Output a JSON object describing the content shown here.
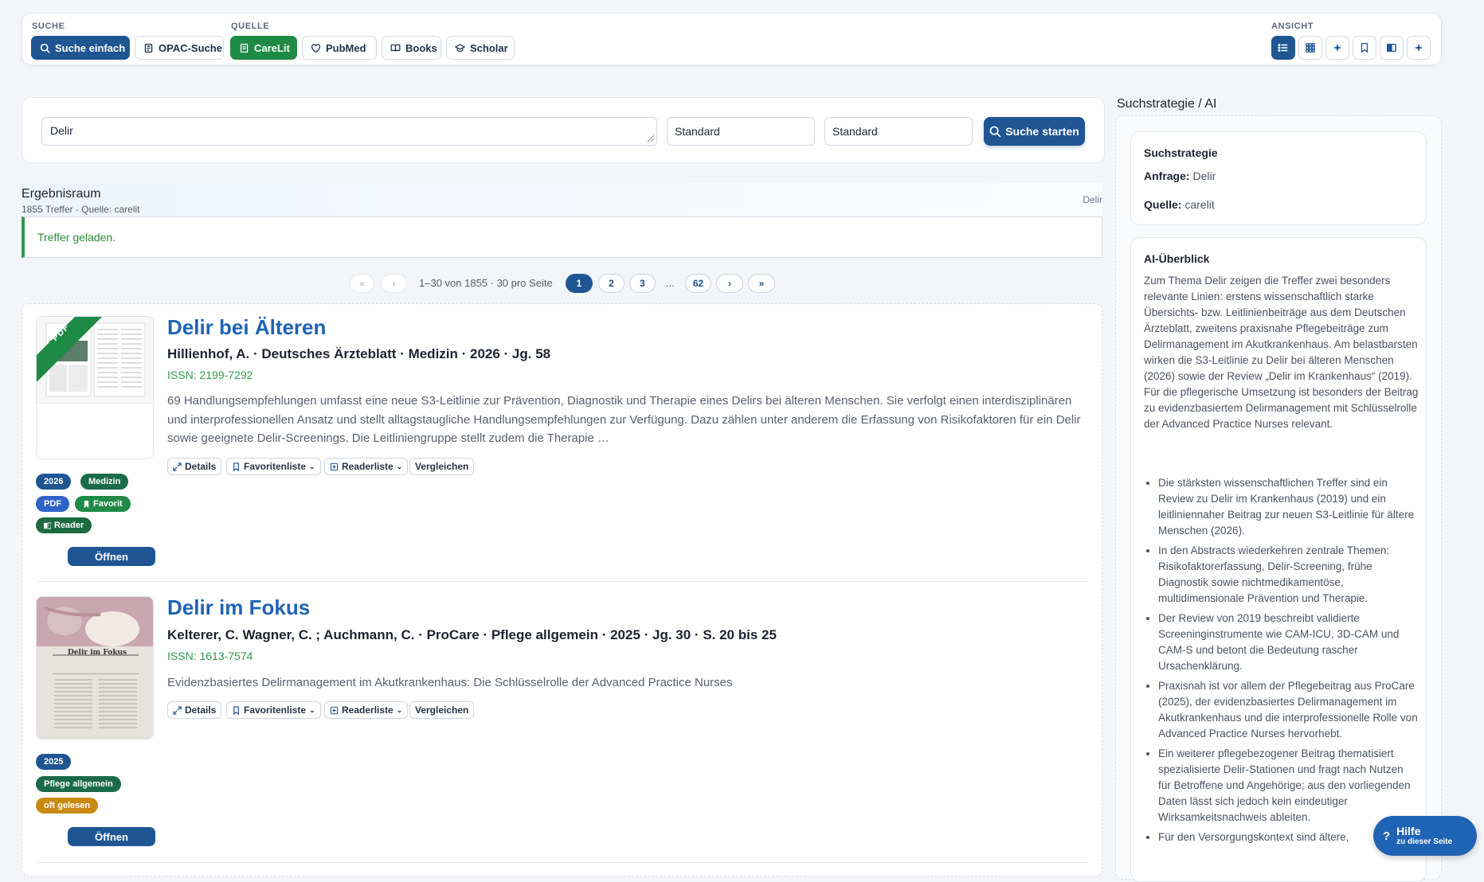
{
  "toolbar": {
    "suche_label": "SUCHE",
    "quelle_label": "QUELLE",
    "ansicht_label": "ANSICHT",
    "buttons": {
      "suche_einfach": "Suche einfach",
      "opac_suche": "OPAC-Suche",
      "carelit": "CareLit",
      "pubmed": "PubMed",
      "books": "Books",
      "scholar": "Scholar"
    },
    "colors": {
      "primary": "#1f5593",
      "carelit_active": "#1e8a45"
    }
  },
  "search": {
    "query": "Delir",
    "select1": "Standard",
    "select2": "Standard",
    "submit_label": "Suche starten"
  },
  "results": {
    "title": "Ergebnisraum",
    "summary": "1855 Treffer · Quelle: carelit",
    "query_tag": "Delir",
    "status": "Treffer geladen.",
    "pager": {
      "first": "«",
      "prev": "‹",
      "info": "1–30 von 1855 · 30 pro Seite",
      "pages": [
        "1",
        "2",
        "3"
      ],
      "ellipsis": "...",
      "last_page": "62",
      "next": "›",
      "last": "»"
    },
    "items": [
      {
        "title": "Delir bei Älteren",
        "meta": "Hillienhof, A. · Deutsches Ärzteblatt · Medizin · 2026 · Jg. 58",
        "issn": "ISSN: 2199-7292",
        "abstract": "69 Handlungsempfehlungen umfasst eine neue S3-Leitlinie zur Prävention, Diagnostik und Therapie eines Delirs bei älteren Menschen. Sie verfolgt einen interdiszi­plinären und interprofessionellen Ansatz und stellt alltagstaugliche Handlungsempfehlungen zur Verfügung. Dazu zählen unter anderem die Erfassung von Risikofak­toren für ein Delir sowie geeignete Delir-Screenings. Die Leitliniengruppe stellt zudem die Therapie …",
        "cover_ribbon": "PDF",
        "badges": {
          "year": "2026",
          "subject": "Medizin",
          "pdf": "PDF",
          "favorit": "Favorit",
          "reader": "Reader"
        },
        "open": "Öffnen"
      },
      {
        "title": "Delir im Fokus",
        "meta": "Kelterer, C. Wagner, C. ; Auchmann, C. · ProCare · Pflege allgemein · 2025 · Jg. 30 · S. 20 bis 25",
        "issn": "ISSN: 1613-7574",
        "abstract": "Evidenzbasiertes Delirmanagement im Akutkrankenhaus: Die Schlüsselrolle der Advanced Practice Nurses",
        "cover_heading": "Delir im Fokus",
        "badges": {
          "year": "2025",
          "subject": "Pflege allgemein",
          "popular": "oft gelesen"
        },
        "open": "Öffnen"
      }
    ],
    "actions": {
      "details": "Details",
      "favoritenliste": "Favoritenliste",
      "readerliste": "Readerliste",
      "vergleichen": "Vergleichen"
    }
  },
  "sidebar": {
    "title": "Suchstrategie / AI",
    "strategy": {
      "heading": "Suchstrategie",
      "anfrage_label": "Anfrage:",
      "anfrage_value": "Delir",
      "quelle_label": "Quelle:",
      "quelle_value": "carelit"
    },
    "ai": {
      "heading": "AI-Überblick",
      "intro": "Zum Thema Delir zeigen die Treffer zwei besonders relevante Linien: erstens wissenschaftlich starke Übersichts- bzw. Leitlinienbeiträge aus dem Deutschen Ärzteblatt, zweitens praxisnahe Pflegebeiträge zum Delirmanagement im Akutkrankenhaus. Am belastbarsten wirken die S3-Leitlinie zu Delir bei älteren Menschen (2026) sowie der Review „Delir im Krankenhaus“ (2019). Für die pflegerische Umsetzung ist besonders der Beitrag zu evidenzbasiertem Delirmanagement mit Schlüsselrolle der Advanced Practice Nurses relevant.",
      "bullets": [
        "Die stärksten wissenschaftlichen Treffer sind ein Review zu Delir im Krankenhaus (2019) und ein leitliniennaher Beitrag zur neuen S3-Leitlinie für ältere Menschen (2026).",
        "In den Abstracts wiederkehren zentrale Themen: Risikofaktorerfassung, Delir-Screening, frühe Diagnostik sowie nichtmedikamentöse, multidimensionale Prävention und Therapie.",
        "Der Review von 2019 beschreibt validierte Screeninginstrumente wie CAM-ICU, 3D-CAM und CAM-S und betont die Bedeutung rascher Ursachenklärung.",
        "Praxisnah ist vor allem der Pflegebeitrag aus ProCare (2025), der evidenzbasiertes Delirmanagement im Akutkrankenhaus und die interprofessionelle Rolle von Advanced Practice Nurses hervorhebt.",
        "Ein weiterer pflegebezogener Beitrag thematisiert spezialisierte Delir-Stationen und fragt nach Nutzen für Betroffene und Angehörige; aus den vorliegenden Daten lässt sich jedoch kein eindeutiger Wirksamkeitsnachweis ableiten.",
        "Für den Versorgungskontext sind ältere,"
      ]
    }
  },
  "help": {
    "label": "Hilfe",
    "sub": "zu dieser Seite",
    "icon": "?"
  }
}
